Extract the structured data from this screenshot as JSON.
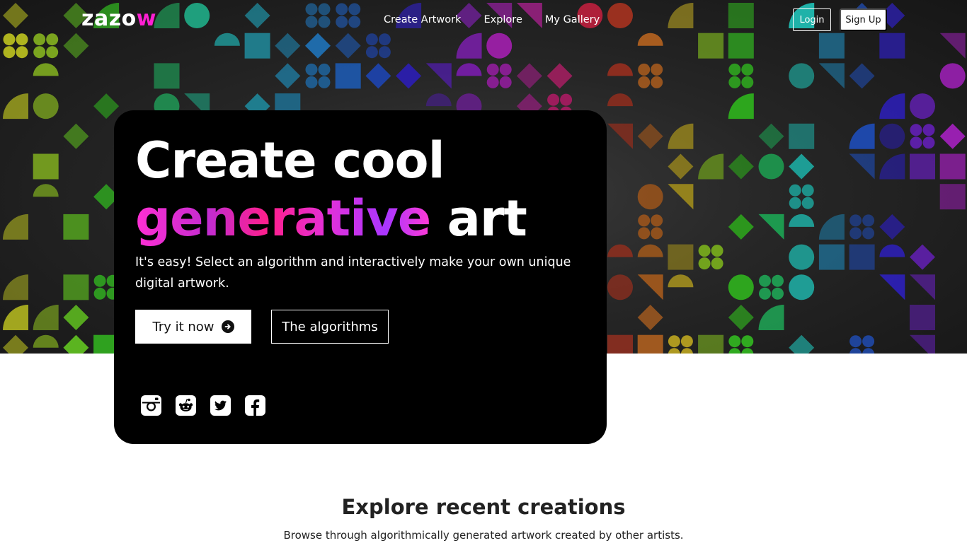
{
  "brand": {
    "logo_main": "zazo",
    "logo_accent": "w",
    "accent_color": "#ff1fd2"
  },
  "nav": {
    "links": [
      "Create Artwork",
      "Explore",
      "My Gallery"
    ],
    "login_label": "Login",
    "signup_label": "Sign Up"
  },
  "hero": {
    "headline_line1": "Create cool",
    "headline_gen_word": "generative",
    "headline_art_word": "art",
    "subtext": "It's easy! Select an algorithm and interactively make your own unique digital artwork.",
    "primary_button_label": "Try it now",
    "secondary_button_label": "The algorithms",
    "social_icons": [
      "instagram-icon",
      "reddit-icon",
      "twitter-icon",
      "facebook-icon"
    ]
  },
  "explore": {
    "title": "Explore recent creations",
    "subtitle": "Browse through algorithmically generated artwork created by other artists."
  }
}
